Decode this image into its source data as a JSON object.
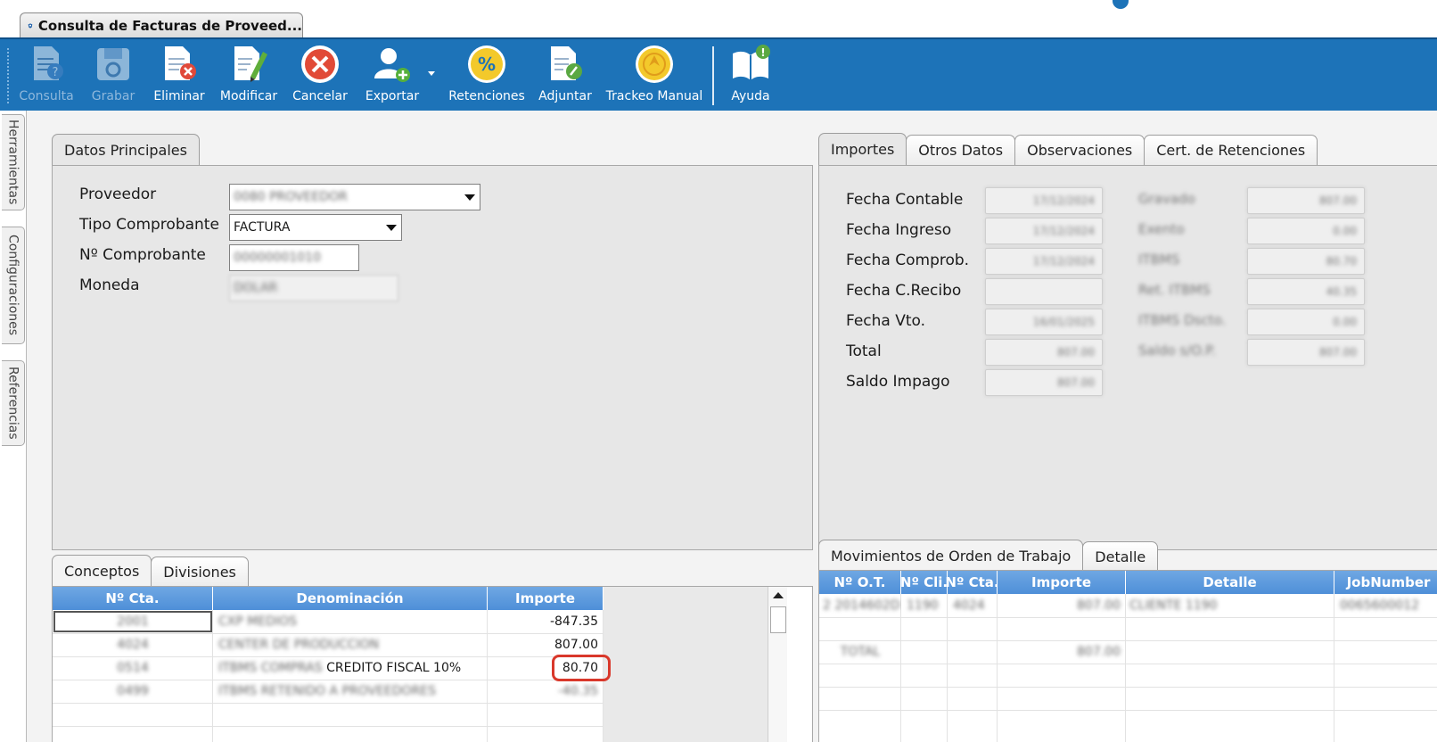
{
  "window": {
    "title": "Consulta de Facturas de Proveed..."
  },
  "colors": {
    "accent": "#1d73b8",
    "grid_header": "#5b9ade",
    "highlight": "#d9382b"
  },
  "toolbar": {
    "buttons": [
      {
        "label": "Consulta",
        "icon": "consult-document-icon",
        "enabled": false
      },
      {
        "label": "Grabar",
        "icon": "save-disk-icon",
        "enabled": false
      },
      {
        "label": "Eliminar",
        "icon": "delete-document-icon",
        "enabled": true
      },
      {
        "label": "Modificar",
        "icon": "edit-pencil-icon",
        "enabled": true
      },
      {
        "label": "Cancelar",
        "icon": "cancel-circle-icon",
        "enabled": true
      },
      {
        "label": "Exportar",
        "icon": "export-user-icon",
        "enabled": true
      },
      {
        "label": "Retenciones",
        "icon": "percent-icon",
        "enabled": true
      },
      {
        "label": "Adjuntar",
        "icon": "attach-document-icon",
        "enabled": true
      },
      {
        "label": "Trackeo Manual",
        "icon": "tracking-icon",
        "enabled": true
      },
      {
        "label": "Ayuda",
        "icon": "help-book-icon",
        "enabled": true
      }
    ]
  },
  "side_tabs": [
    "Herramientas",
    "Configuraciones",
    "Referencias"
  ],
  "main_panel": {
    "tab": "Datos Principales",
    "fields": {
      "proveedor": {
        "label": "Proveedor",
        "value": "0080 PROVEEDOR"
      },
      "tipo": {
        "label": "Tipo Comprobante",
        "value": "FACTURA"
      },
      "numero": {
        "label": "Nº Comprobante",
        "value": "00000001010"
      },
      "moneda": {
        "label": "Moneda",
        "value": "DOLAR"
      }
    }
  },
  "right_panel": {
    "tabs": [
      "Importes",
      "Otros Datos",
      "Observaciones",
      "Cert. de Retenciones"
    ],
    "left_fields": [
      {
        "label": "Fecha Contable",
        "value": "17/12/2024"
      },
      {
        "label": "Fecha Ingreso",
        "value": "17/12/2024"
      },
      {
        "label": "Fecha Comprob.",
        "value": "17/12/2024"
      },
      {
        "label": "Fecha C.Recibo",
        "value": ""
      },
      {
        "label": "Fecha Vto.",
        "value": "16/01/2025"
      },
      {
        "label": "Total",
        "value": "807.00"
      },
      {
        "label": "Saldo Impago",
        "value": "807.00"
      }
    ],
    "right_fields": [
      {
        "label": "Gravado",
        "value": "807.00"
      },
      {
        "label": "Exento",
        "value": "0.00"
      },
      {
        "label": "ITBMS",
        "value": "80.70"
      },
      {
        "label": "Ret. ITBMS",
        "value": "40.35"
      },
      {
        "label": "ITBMS Dscto.",
        "value": "0.00"
      },
      {
        "label": "Saldo s/O.P.",
        "value": "807.00"
      }
    ]
  },
  "conceptos": {
    "tabs": [
      "Conceptos",
      "Divisiones"
    ],
    "columns": [
      "Nº Cta.",
      "Denominación",
      "Importe"
    ],
    "rows": [
      {
        "cta": "2001",
        "den": "CXP MEDIOS",
        "den_clear": "",
        "imp": "-847.35"
      },
      {
        "cta": "4024",
        "den": "CENTER DE PRODUCCION",
        "den_clear": "",
        "imp": "807.00"
      },
      {
        "cta": "0514",
        "den": "ITBMS COMPRAS",
        "den_clear": "CREDITO FISCAL 10%",
        "imp": "80.70"
      },
      {
        "cta": "0499",
        "den": "ITBMS RETENIDO A PROVEEDORES",
        "den_clear": "",
        "imp": "-40.35"
      }
    ]
  },
  "movimientos": {
    "tabs": [
      "Movimientos de Orden de Trabajo",
      "Detalle"
    ],
    "columns": [
      "Nº O.T.",
      "Nº Cli.",
      "Nº Cta.",
      "Importe",
      "Detalle",
      "JobNumber"
    ],
    "rows": [
      {
        "ot": "2 2014602D",
        "cli": "1190",
        "cta": "4024",
        "imp": "807.00",
        "det": "CLIENTE 1190",
        "job": "0065600012"
      },
      {
        "ot": "",
        "cli": "",
        "cta": "",
        "imp": "",
        "det": "",
        "job": ""
      },
      {
        "ot": "TOTAL",
        "cli": "",
        "cta": "",
        "imp": "807.00",
        "det": "",
        "job": ""
      }
    ]
  }
}
